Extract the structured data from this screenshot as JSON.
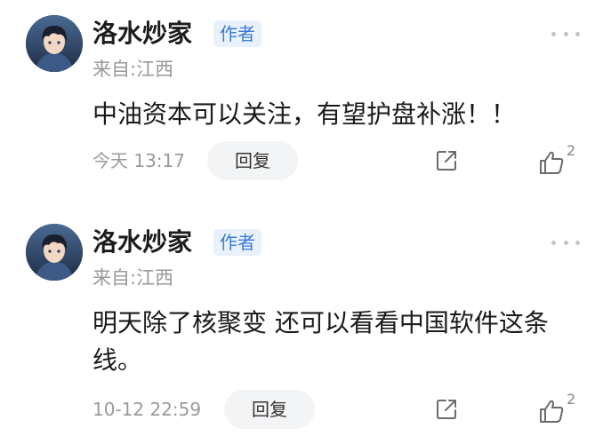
{
  "comments": [
    {
      "username": "洛水炒家",
      "badge": "作者",
      "location": "来自:江西",
      "content": "中油资本可以关注，有望护盘补涨！！",
      "time": "今天 13:17",
      "reply_label": "回复",
      "like_count": "2"
    },
    {
      "username": "洛水炒家",
      "badge": "作者",
      "location": "来自:江西",
      "content": "明天除了核聚变 还可以看看中国软件这条线。",
      "time": "10-12 22:59",
      "reply_label": "回复",
      "like_count": "2"
    }
  ],
  "colors": {
    "badge_bg": "#e8f1fc",
    "badge_text": "#3b7ad6",
    "meta_text": "#999999",
    "reply_bg": "#f3f4f6"
  },
  "icons": {
    "more": "more-horizontal-icon",
    "share": "share-icon",
    "like": "thumbs-up-icon"
  }
}
